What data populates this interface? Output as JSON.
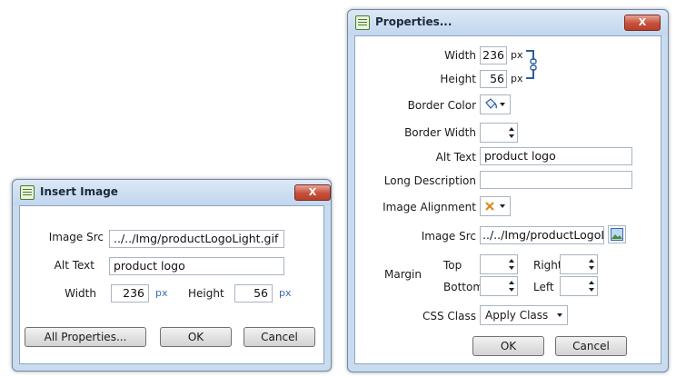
{
  "insert_dialog": {
    "title": "Insert Image",
    "close_symbol": "X",
    "image_src_label": "Image Src",
    "image_src_value": "../../Img/productLogoLight.gif",
    "alt_text_label": "Alt Text",
    "alt_text_value": "product logo",
    "width_label": "Width",
    "width_value": "236",
    "width_unit": "px",
    "height_label": "Height",
    "height_value": "56",
    "height_unit": "px",
    "all_properties_label": "All Properties...",
    "ok_label": "OK",
    "cancel_label": "Cancel"
  },
  "properties_dialog": {
    "title": "Properties...",
    "close_symbol": "X",
    "width_label": "Width",
    "width_value": "236",
    "width_unit": "px",
    "height_label": "Height",
    "height_value": "56",
    "height_unit": "px",
    "border_color_label": "Border Color",
    "border_width_label": "Border Width",
    "alt_text_label": "Alt Text",
    "alt_text_value": "product logo",
    "long_description_label": "Long Description",
    "long_description_value": "",
    "image_alignment_label": "Image Alignment",
    "image_src_label": "Image Src",
    "image_src_value": "../../Img/productLogoLight.gif",
    "margin_label": "Margin",
    "margin_top_label": "Top",
    "margin_right_label": "Right",
    "margin_bottom_label": "Bottom",
    "margin_left_label": "Left",
    "css_class_label": "CSS Class",
    "css_class_value": "Apply Class",
    "ok_label": "OK",
    "cancel_label": "Cancel"
  },
  "colors": {
    "frame": "#c9dbef",
    "close_button": "#c6503a",
    "unit_text": "#3a6ab0"
  },
  "icons": {
    "dialog_icon": "window-icon",
    "constrain_proportions": "chain-link-icon",
    "border_color": "paint-bucket-icon",
    "image_alignment": "alignment-x-icon",
    "image_browse": "image-browse-icon"
  }
}
